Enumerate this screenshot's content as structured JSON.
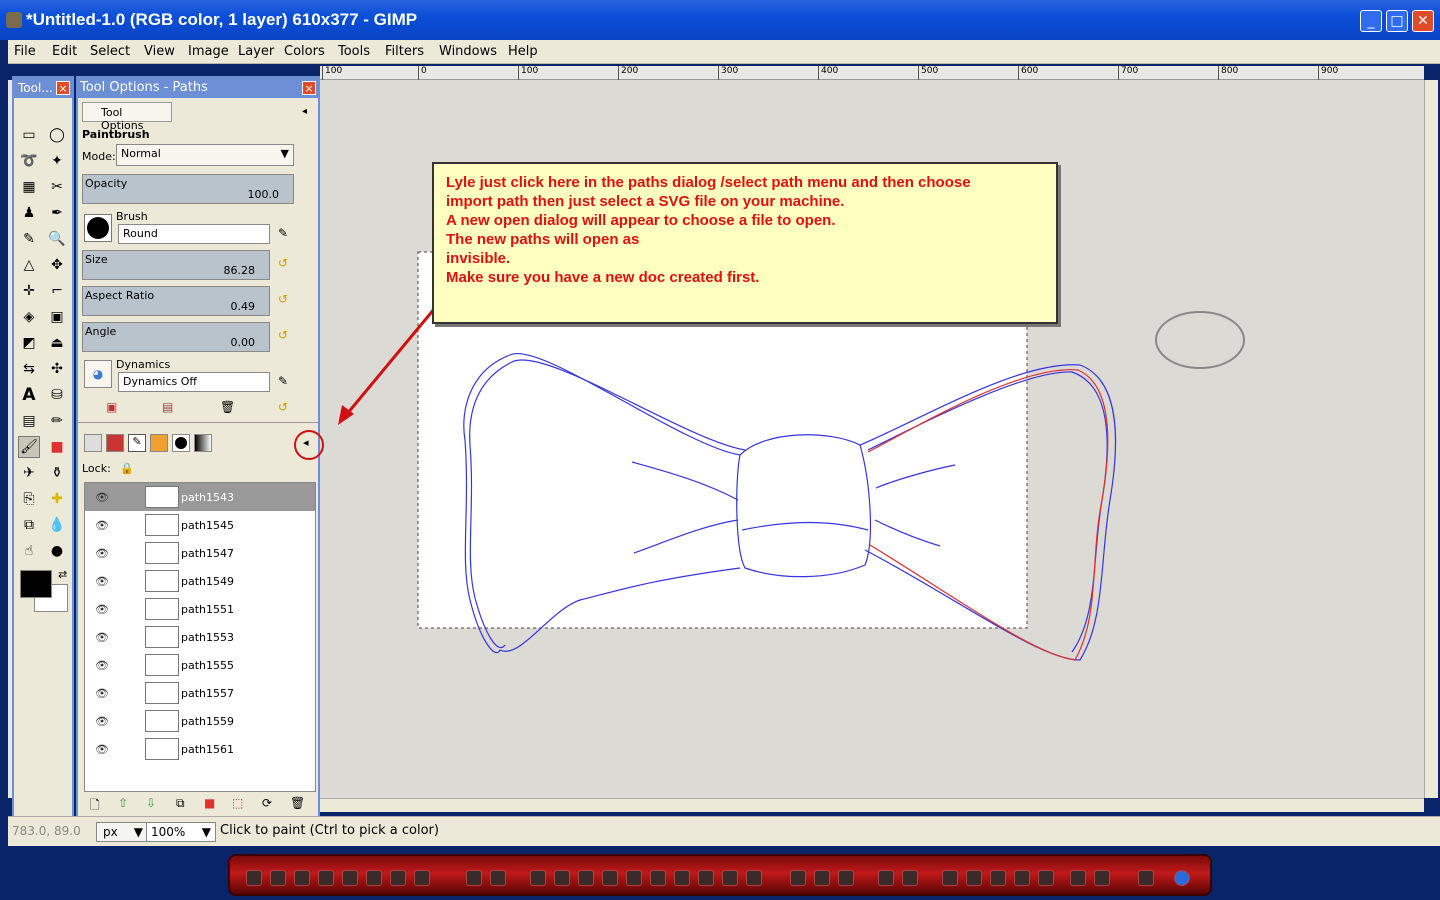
{
  "window": {
    "title": "*Untitled-1.0 (RGB color, 1 layer) 610x377 - GIMP",
    "buttons": {
      "minimize": "_",
      "maximize": "□",
      "close": "✕"
    }
  },
  "menu": [
    "File",
    "Edit",
    "Select",
    "View",
    "Image",
    "Layer",
    "Colors",
    "Tools",
    "Filters",
    "Windows",
    "Help"
  ],
  "ruler": [
    "100",
    "0",
    "100",
    "200",
    "300",
    "400",
    "500",
    "600",
    "700",
    "800",
    "900"
  ],
  "toolbox": {
    "title": "Tool..."
  },
  "dock": {
    "title": "Tool Options - Paths",
    "tab": "Tool Options",
    "tool_name": "Paintbrush",
    "mode_label": "Mode:",
    "mode_value": "Normal",
    "opacity_label": "Opacity",
    "opacity_value": "100.0",
    "brush_label": "Brush",
    "brush_value": "Round",
    "size_label": "Size",
    "size_value": "86.28",
    "aspect_label": "Aspect Ratio",
    "aspect_value": "0.49",
    "angle_label": "Angle",
    "angle_value": "0.00",
    "dynamics_label": "Dynamics",
    "dynamics_value": "Dynamics Off",
    "lock_label": "Lock:"
  },
  "paths": [
    {
      "name": "path1543",
      "selected": true
    },
    {
      "name": "path1545",
      "selected": false
    },
    {
      "name": "path1547",
      "selected": false
    },
    {
      "name": "path1549",
      "selected": false
    },
    {
      "name": "path1551",
      "selected": false
    },
    {
      "name": "path1553",
      "selected": false
    },
    {
      "name": "path1555",
      "selected": false
    },
    {
      "name": "path1557",
      "selected": false
    },
    {
      "name": "path1559",
      "selected": false
    },
    {
      "name": "path1561",
      "selected": false
    }
  ],
  "callout": {
    "lines": [
      "Lyle just click here in the paths dialog /select path menu and then choose",
      "import path then just select a SVG file on your machine.",
      "A new open dialog will appear to choose a file to open.",
      "The new paths will open as",
      "invisible.",
      "Make sure you have a new doc created first."
    ]
  },
  "status": {
    "coords": "783.0, 89.0",
    "unit": "px",
    "zoom": "100",
    "zoom_suffix": "%",
    "message": "Click to paint (Ctrl to pick a color)"
  },
  "colors": {
    "accent": "#6d8fd6",
    "callout_text": "#e01010",
    "path_stroke": "#3030e0",
    "path_red": "#e03030"
  }
}
